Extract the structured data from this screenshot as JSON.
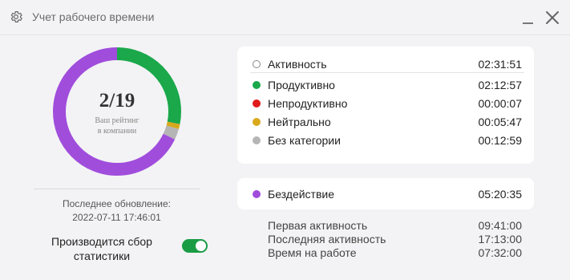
{
  "window": {
    "title": "Учет рабочего времени"
  },
  "rating": {
    "rank": "2/19",
    "caption_line1": "Ваш рейтинг",
    "caption_line2": "в компании"
  },
  "update": {
    "label": "Последнее обновление:",
    "datetime": "2022-07-11 17:46:01"
  },
  "collecting": {
    "label_line1": "Производится сбор",
    "label_line2": "статистики",
    "enabled": true
  },
  "activity": {
    "header": {
      "label": "Активность",
      "value": "02:31:51"
    },
    "categories": [
      {
        "label": "Продуктивно",
        "value": "02:12:57",
        "color": "#1aa84a"
      },
      {
        "label": "Непродуктивно",
        "value": "00:00:07",
        "color": "#e01b1b"
      },
      {
        "label": "Нейтрально",
        "value": "00:05:47",
        "color": "#d8a91b"
      },
      {
        "label": "Без категории",
        "value": "00:12:59",
        "color": "#b5b5b5"
      }
    ]
  },
  "idle": {
    "label": "Бездействие",
    "value": "05:20:35",
    "color": "#a04ddc"
  },
  "summary": [
    {
      "label": "Первая активность",
      "value": "09:41:00"
    },
    {
      "label": "Последняя активность",
      "value": "17:13:00"
    },
    {
      "label": "Время на работе",
      "value": "07:32:00"
    }
  ]
}
